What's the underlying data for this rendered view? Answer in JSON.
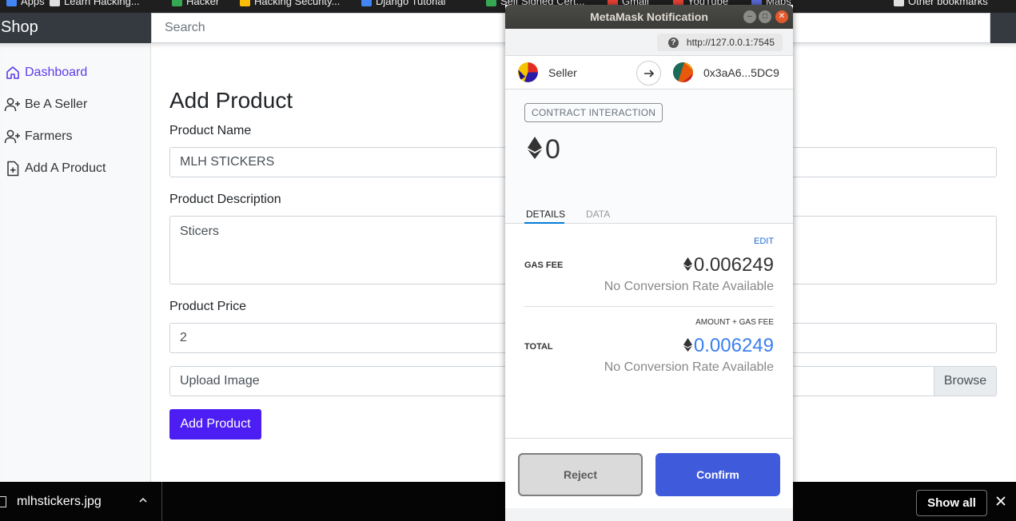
{
  "bookmarks": [
    {
      "label": "Apps",
      "color": "#4285f4"
    },
    {
      "label": "Learn Hacking...",
      "color": "#e0e0e0"
    },
    {
      "label": "Hacker",
      "color": "#34a853"
    },
    {
      "label": "Hacking Security...",
      "color": "#fbbc05"
    },
    {
      "label": "Django Tutorial",
      "color": "#4285f4"
    },
    {
      "label": "Self Signed Cert...",
      "color": "#34a853"
    },
    {
      "label": "Gmail",
      "color": "#ea4335"
    },
    {
      "label": "YouTube",
      "color": "#ea4335"
    },
    {
      "label": "Maps",
      "color": "#5b6bda"
    },
    {
      "label": "Other bookmarks",
      "color": "#e0e0e0"
    }
  ],
  "navbar": {
    "brand": "Shop",
    "search_placeholder": "Search"
  },
  "sidebar": {
    "items": [
      {
        "label": "Dashboard",
        "icon": "home-icon",
        "active": true
      },
      {
        "label": "Be A Seller",
        "icon": "person-add-icon",
        "active": false
      },
      {
        "label": "Farmers",
        "icon": "person-add-icon",
        "active": false
      },
      {
        "label": "Add A Product",
        "icon": "file-add-icon",
        "active": false
      }
    ]
  },
  "form": {
    "title": "Add Product",
    "name_label": "Product Name",
    "name_value": "MLH STICKERS",
    "description_label": "Product Description",
    "description_value": "Sticers",
    "price_label": "Product Price",
    "price_value": "2",
    "upload_label": "Upload Image",
    "browse_label": "Browse",
    "submit_label": "Add Product",
    "accent_color": "#4c1ef3"
  },
  "downloads": {
    "file_name": "mlhstickers.jpg",
    "show_all_label": "Show all"
  },
  "metamask": {
    "title": "MetaMask Notification",
    "origin": "http://127.0.0.1:7545",
    "from_account": "Seller",
    "to_account": "0x3aA6...5DC9",
    "action_label": "CONTRACT INTERACTION",
    "amount": "0",
    "tabs": {
      "details": "DETAILS",
      "data": "DATA"
    },
    "edit_label": "EDIT",
    "gas_fee_label": "GAS FEE",
    "gas_fee_value": "0.006249",
    "gas_fee_sub": "No Conversion Rate Available",
    "amount_gas_label": "AMOUNT + GAS FEE",
    "total_label": "TOTAL",
    "total_value": "0.006249",
    "total_sub": "No Conversion Rate Available",
    "reject_label": "Reject",
    "confirm_label": "Confirm",
    "confirm_color": "#3f5bdb"
  }
}
